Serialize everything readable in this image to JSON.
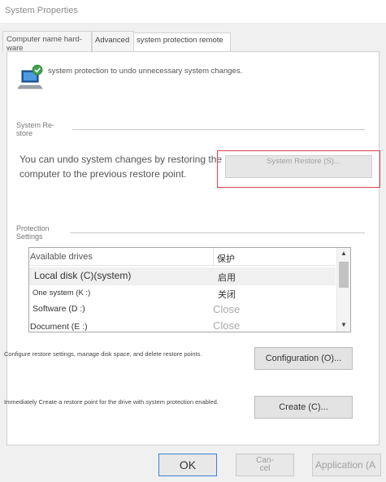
{
  "window": {
    "title": "System Properties"
  },
  "tabs": [
    {
      "label": "Computer name hard-ware"
    },
    {
      "label": "Advanced"
    },
    {
      "label": "system protection remote"
    }
  ],
  "intro": {
    "text": "system protection to undo unnecessary system changes."
  },
  "system_restore": {
    "section_label": "System Re-store",
    "description": "You can undo system changes by restoring the computer to the previous restore point.",
    "button_label": "System Restore (S)..."
  },
  "protection": {
    "section_label": "Protection Settings",
    "columns": [
      "Available drives",
      "保护"
    ],
    "rows": [
      {
        "drive": "Local disk (C)(system)",
        "status": "启用"
      },
      {
        "drive": "One system (K :)",
        "status": "关闭"
      },
      {
        "drive": "Software (D :)",
        "status": "Close"
      },
      {
        "drive": "Document (E :)",
        "status": "Close"
      }
    ]
  },
  "configure": {
    "help": "Configure restore settings, manage disk space, and delete restore points.",
    "button_label": "Configuration (O)..."
  },
  "create": {
    "help": "Immediately Create a restore point for the drive with system protection enabled.",
    "button_label": "Create (C)..."
  },
  "footer": {
    "ok_label": "OK",
    "cancel_label": "Can-cel",
    "apply_label": "Application (A"
  },
  "colors": {
    "accent": "#3b7fd4",
    "highlight": "#d9434f"
  },
  "icons": {
    "system": "computer-shield-icon"
  }
}
